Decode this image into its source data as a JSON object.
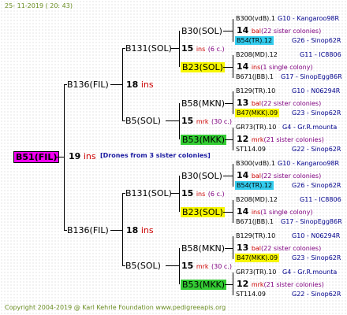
{
  "header": {
    "date": "25- 11-2019 ( 20: 43)"
  },
  "footer": {
    "copyright": "Copyright 2004-2019 @ Karl Kehrle Foundation   www.pedigreeapis.org"
  },
  "root": {
    "label": "B51(FIL)",
    "gen": "19",
    "ins": "ins",
    "note": "[Drones from 3 sister colonies]"
  },
  "l1": {
    "top": {
      "label": "B136(FIL)",
      "gen": "18",
      "ins": "ins"
    },
    "bottom": {
      "label": "B136(FIL)",
      "gen": "18",
      "ins": "ins"
    }
  },
  "l2": {
    "tt": {
      "label": "B131(SOL)",
      "gen": "15",
      "ins": "ins",
      "extra": "(6 c.)"
    },
    "tb": {
      "label": "B5(SOL)",
      "gen": "15",
      "ins": "mrk",
      "extra": "(30 c.)"
    },
    "bt": {
      "label": "B131(SOL)",
      "gen": "15",
      "ins": "ins",
      "extra": "(6 c.)"
    },
    "bb": {
      "label": "B5(SOL)",
      "gen": "15",
      "ins": "mrk",
      "extra": "(30 c.)"
    }
  },
  "l3": [
    {
      "label": "B30(SOL)"
    },
    {
      "label": "B23(SOL)"
    },
    {
      "label": "B58(MKN)"
    },
    {
      "label": "B53(MKK)"
    },
    {
      "label": "B30(SOL)"
    },
    {
      "label": "B23(SOL)"
    },
    {
      "label": "B58(MKN)"
    },
    {
      "label": "B53(MKK)"
    }
  ],
  "l4": [
    {
      "a": "B300(vdB).1",
      "b": "G10 - Kangaroo98R",
      "num": "14",
      "c": "bal",
      "d": "(22 sister colonies)",
      "e": "B54(TR).12",
      "f": "G26 - Sinop62R"
    },
    {
      "a": "B208(MD).12",
      "b": "G11 - IC8806",
      "num": "14",
      "c": "ins",
      "d": "(1 single colony)",
      "e": "B671(JBB).1",
      "f": "G17 - SinopEgg86R"
    },
    {
      "a": "B129(TR).10",
      "b": "G10 - N06294R",
      "num": "13",
      "c": "bal",
      "d": "(22 sister colonies)",
      "e": "B47(MKK).09",
      "f": "G23 - Sinop62R"
    },
    {
      "a": "GR73(TR).10",
      "b": "G4 - Gr.R.mounta",
      "num": "12",
      "c": "mrk",
      "d": "(21 sister colonies)",
      "e": "ST114.09",
      "f": "G22 - Sinop62R"
    },
    {
      "a": "B300(vdB).1",
      "b": "G10 - Kangaroo98R",
      "num": "14",
      "c": "bal",
      "d": "(22 sister colonies)",
      "e": "B54(TR).12",
      "f": "G26 - Sinop62R"
    },
    {
      "a": "B208(MD).12",
      "b": "G11 - IC8806",
      "num": "14",
      "c": "ins",
      "d": "(1 single colony)",
      "e": "B671(JBB).1",
      "f": "G17 - SinopEgg86R"
    },
    {
      "a": "B129(TR).10",
      "b": "G10 - N06294R",
      "num": "13",
      "c": "bal",
      "d": "(22 sister colonies)",
      "e": "B47(MKK).09",
      "f": "G23 - Sinop62R"
    },
    {
      "a": "GR73(TR).10",
      "b": "G4 - Gr.R.mounta",
      "num": "12",
      "c": "mrk",
      "d": "(21 sister colonies)",
      "e": "ST114.09",
      "f": "G22 - Sinop62R"
    }
  ],
  "colors": {
    "root": "#f200f2",
    "yellow": "#f6f600",
    "cyan": "#33ccee",
    "green": "#33cc33",
    "red": "#cc0000",
    "purple": "#800080",
    "blue": "#00008b"
  }
}
